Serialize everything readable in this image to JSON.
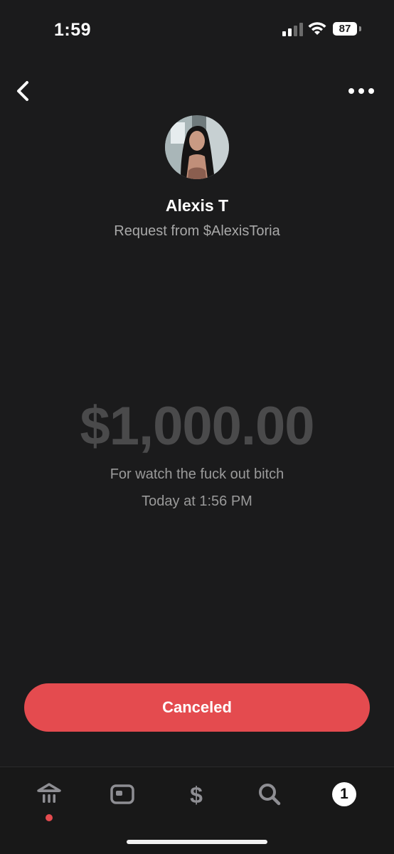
{
  "status_bar": {
    "time": "1:59",
    "battery_level": "87"
  },
  "header": {
    "back_icon": "chevron-left-icon",
    "more_icon": "more-horizontal-icon"
  },
  "profile": {
    "name": "Alexis T",
    "subtitle": "Request from $AlexisToria"
  },
  "payment": {
    "amount": "$1,000.00",
    "note": "For watch the fuck out bitch",
    "date": "Today at 1:56 PM"
  },
  "action": {
    "label": "Canceled",
    "color": "#e44b4f"
  },
  "tabbar": {
    "tabs": [
      {
        "icon": "bank-icon",
        "has_notification_dot": true
      },
      {
        "icon": "card-icon"
      },
      {
        "icon": "dollar-icon"
      },
      {
        "icon": "search-icon"
      },
      {
        "icon": "activity-badge",
        "badge": "1"
      }
    ]
  }
}
